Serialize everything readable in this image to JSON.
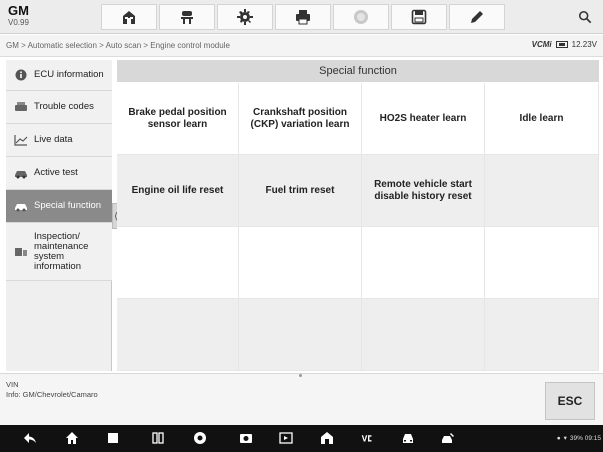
{
  "header": {
    "brand": "GM",
    "version": "V0.99",
    "toolbar": [
      {
        "icon": "home-icon"
      },
      {
        "icon": "vehicle-lift-icon"
      },
      {
        "icon": "settings-gear-icon"
      },
      {
        "icon": "print-icon"
      },
      {
        "icon": "help-icon"
      },
      {
        "icon": "save-icon"
      },
      {
        "icon": "edit-pen-icon"
      }
    ],
    "search_icon": "search-icon"
  },
  "breadcrumb": "GM > Automatic selection > Auto scan > Engine control module",
  "vci": {
    "label": "VCMi",
    "voltage": "12.23V"
  },
  "sidebar": {
    "items": [
      {
        "label": "ECU information",
        "icon": "info-icon"
      },
      {
        "label": "Trouble codes",
        "icon": "trouble-codes-icon"
      },
      {
        "label": "Live data",
        "icon": "live-data-chart-icon"
      },
      {
        "label": "Active test",
        "icon": "active-test-icon"
      },
      {
        "label": "Special function",
        "icon": "special-function-icon",
        "active": true
      },
      {
        "label": "Inspection/ maintenance system information",
        "icon": "inspection-icon"
      }
    ]
  },
  "main": {
    "title": "Special function",
    "functions": [
      "Brake pedal position sensor learn",
      "Crankshaft position (CKP) variation learn",
      "HO2S heater learn",
      "Idle learn",
      "Engine oil life reset",
      "Fuel trim reset",
      "Remote vehicle start disable history reset"
    ]
  },
  "footer": {
    "vin_label": "VIN",
    "info": "Info: GM/Chevrolet/Camaro",
    "esc": "ESC"
  },
  "system_status": "39%  09:15"
}
